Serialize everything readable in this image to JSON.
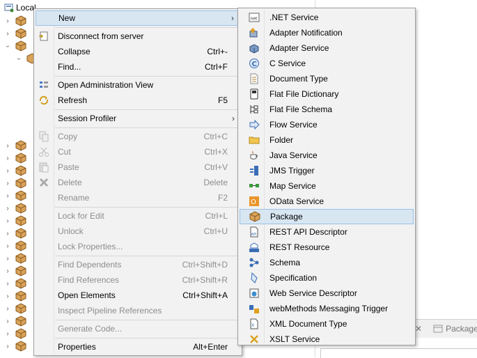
{
  "tree": {
    "root_label": "Local"
  },
  "context_menu": {
    "items": [
      {
        "label": "New",
        "shortcut": "",
        "disabled": false,
        "submenu": true
      },
      {
        "label": "Disconnect from server",
        "shortcut": "",
        "disabled": false
      },
      {
        "label": "Collapse",
        "shortcut": "Ctrl+-",
        "disabled": false
      },
      {
        "label": "Find...",
        "shortcut": "Ctrl+F",
        "disabled": false
      },
      {
        "label": "Open Administration View",
        "shortcut": "",
        "disabled": false
      },
      {
        "label": "Refresh",
        "shortcut": "F5",
        "disabled": false
      },
      {
        "label": "Session Profiler",
        "shortcut": "",
        "disabled": false,
        "submenu": true
      },
      {
        "label": "Copy",
        "shortcut": "Ctrl+C",
        "disabled": true
      },
      {
        "label": "Cut",
        "shortcut": "Ctrl+X",
        "disabled": true
      },
      {
        "label": "Paste",
        "shortcut": "Ctrl+V",
        "disabled": true
      },
      {
        "label": "Delete",
        "shortcut": "Delete",
        "disabled": true
      },
      {
        "label": "Rename",
        "shortcut": "F2",
        "disabled": true
      },
      {
        "label": "Lock for Edit",
        "shortcut": "Ctrl+L",
        "disabled": true
      },
      {
        "label": "Unlock",
        "shortcut": "Ctrl+U",
        "disabled": true
      },
      {
        "label": "Lock Properties...",
        "shortcut": "",
        "disabled": true
      },
      {
        "label": "Find Dependents",
        "shortcut": "Ctrl+Shift+D",
        "disabled": true
      },
      {
        "label": "Find References",
        "shortcut": "Ctrl+Shift+R",
        "disabled": true
      },
      {
        "label": "Open Elements",
        "shortcut": "Ctrl+Shift+A",
        "disabled": false
      },
      {
        "label": "Inspect Pipeline References",
        "shortcut": "",
        "disabled": true
      },
      {
        "label": "Generate Code...",
        "shortcut": "",
        "disabled": true
      },
      {
        "label": "Properties",
        "shortcut": "Alt+Enter",
        "disabled": false
      }
    ]
  },
  "new_submenu": {
    "items": [
      {
        "label": ".NET Service",
        "icon": "dotnet-icon"
      },
      {
        "label": "Adapter Notification",
        "icon": "adapter-notification-icon"
      },
      {
        "label": "Adapter Service",
        "icon": "adapter-service-icon"
      },
      {
        "label": "C Service",
        "icon": "c-service-icon"
      },
      {
        "label": "Document Type",
        "icon": "document-type-icon"
      },
      {
        "label": "Flat File Dictionary",
        "icon": "flat-file-dictionary-icon"
      },
      {
        "label": "Flat File Schema",
        "icon": "flat-file-schema-icon"
      },
      {
        "label": "Flow Service",
        "icon": "flow-service-icon"
      },
      {
        "label": "Folder",
        "icon": "folder-icon"
      },
      {
        "label": "Java Service",
        "icon": "java-service-icon"
      },
      {
        "label": "JMS Trigger",
        "icon": "jms-trigger-icon"
      },
      {
        "label": "Map Service",
        "icon": "map-service-icon"
      },
      {
        "label": "OData Service",
        "icon": "odata-service-icon"
      },
      {
        "label": "Package",
        "icon": "package-icon",
        "highlighted": true
      },
      {
        "label": "REST API Descriptor",
        "icon": "rest-api-descriptor-icon"
      },
      {
        "label": "REST Resource",
        "icon": "rest-resource-icon"
      },
      {
        "label": "Schema",
        "icon": "schema-icon"
      },
      {
        "label": "Specification",
        "icon": "specification-icon"
      },
      {
        "label": "Web Service Descriptor",
        "icon": "web-service-descriptor-icon"
      },
      {
        "label": "webMethods Messaging Trigger",
        "icon": "messaging-trigger-icon"
      },
      {
        "label": "XML Document Type",
        "icon": "xml-document-type-icon"
      },
      {
        "label": "XSLT Service",
        "icon": "xslt-service-icon"
      }
    ]
  },
  "right_panel": {
    "tab_label": "Package"
  },
  "colors": {
    "menu_bg": "#f2f2f2",
    "highlight_bg": "#d8e6f2",
    "highlight_border": "#99c1e6",
    "disabled_text": "#8d8d8d"
  }
}
